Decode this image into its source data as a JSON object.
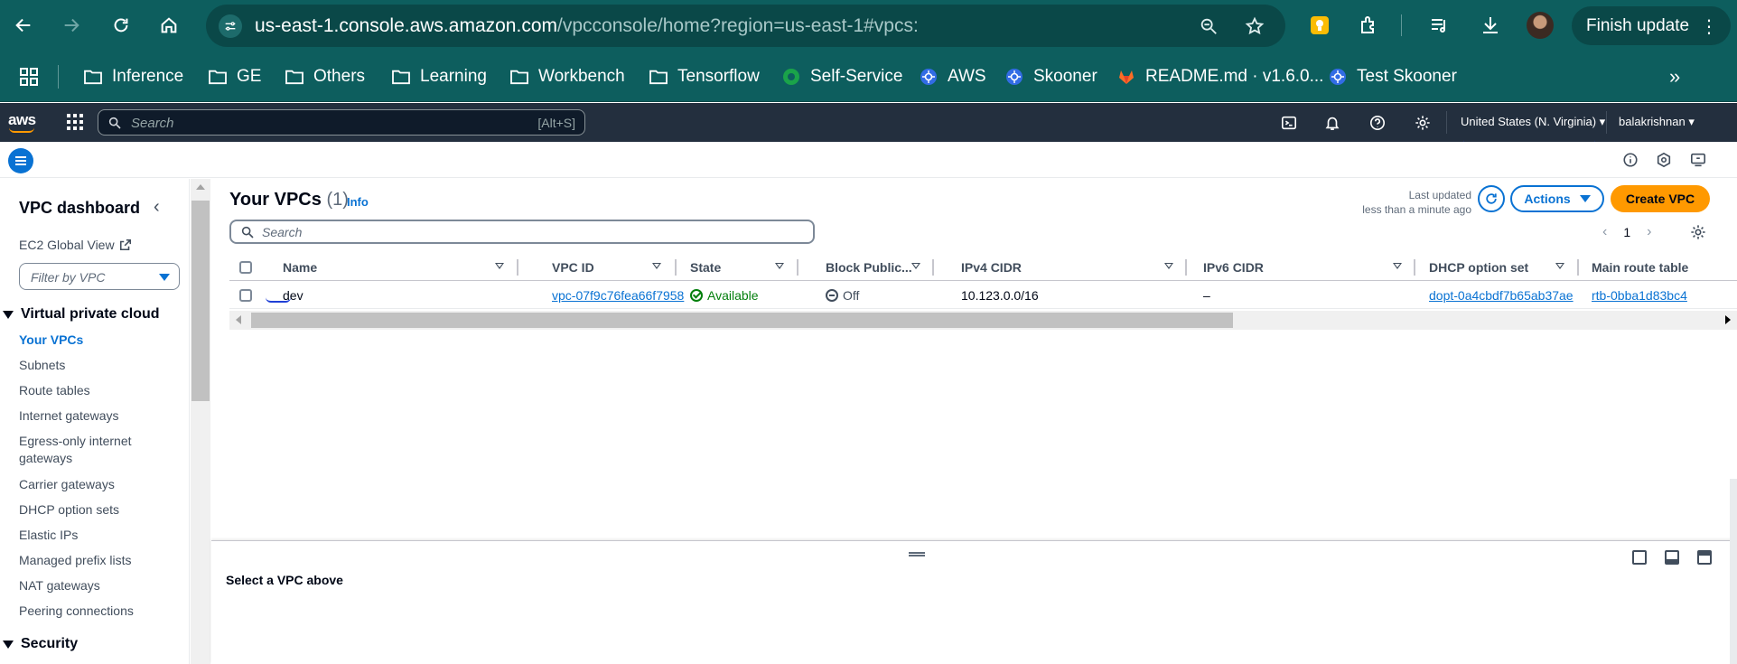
{
  "browser": {
    "url_host": "us-east-1.console.aws.amazon.com",
    "url_path": "/vpcconsole/home?region=us-east-1#vpcs:",
    "finish_update": "Finish update",
    "bookmarks": [
      {
        "label": "Inference",
        "icon": "folder-icon"
      },
      {
        "label": "GE",
        "icon": "folder-icon"
      },
      {
        "label": "Others",
        "icon": "folder-icon"
      },
      {
        "label": "Learning",
        "icon": "folder-icon"
      },
      {
        "label": "Workbench",
        "icon": "folder-icon"
      },
      {
        "label": "Tensorflow",
        "icon": "folder-icon"
      },
      {
        "label": "Self-Service",
        "icon": "self-service-icon"
      },
      {
        "label": "AWS",
        "icon": "kubernetes-icon"
      },
      {
        "label": "Skooner",
        "icon": "kubernetes-icon"
      },
      {
        "label": "README.md · v1.6.0...",
        "icon": "gitlab-icon"
      },
      {
        "label": "Test Skooner",
        "icon": "kubernetes-icon"
      }
    ]
  },
  "aws": {
    "search_placeholder": "Search",
    "search_shortcut": "[Alt+S]",
    "region": "United States (N. Virginia)",
    "user": "balakrishnan"
  },
  "sidebar": {
    "title": "VPC dashboard",
    "ec2_global": "EC2 Global View",
    "filter_placeholder": "Filter by VPC",
    "section1": "Virtual private cloud",
    "items": [
      "Your VPCs",
      "Subnets",
      "Route tables",
      "Internet gateways",
      "Egress-only internet gateways",
      "Carrier gateways",
      "DHCP option sets",
      "Elastic IPs",
      "Managed prefix lists",
      "NAT gateways",
      "Peering connections"
    ],
    "section2": "Security"
  },
  "main": {
    "title": "Your VPCs",
    "count": "(1)",
    "info": "Info",
    "last_updated_1": "Last updated",
    "last_updated_2": "less than a minute ago",
    "actions": "Actions",
    "create": "Create VPC",
    "search_placeholder": "Search",
    "page": "1",
    "columns": [
      "Name",
      "VPC ID",
      "State",
      "Block Public...",
      "IPv4 CIDR",
      "IPv6 CIDR",
      "DHCP option set",
      "Main route table"
    ],
    "row": {
      "name": "dev",
      "vpc_id": "vpc-07f9c76fea66f7958",
      "state": "Available",
      "block_public": "Off",
      "ipv4": "10.123.0.0/16",
      "ipv6": "–",
      "dhcp": "dopt-0a4cbdf7b65ab37ae",
      "main_route": "rtb-0bba1d83bc4"
    }
  },
  "split_panel": {
    "message": "Select a VPC above"
  }
}
